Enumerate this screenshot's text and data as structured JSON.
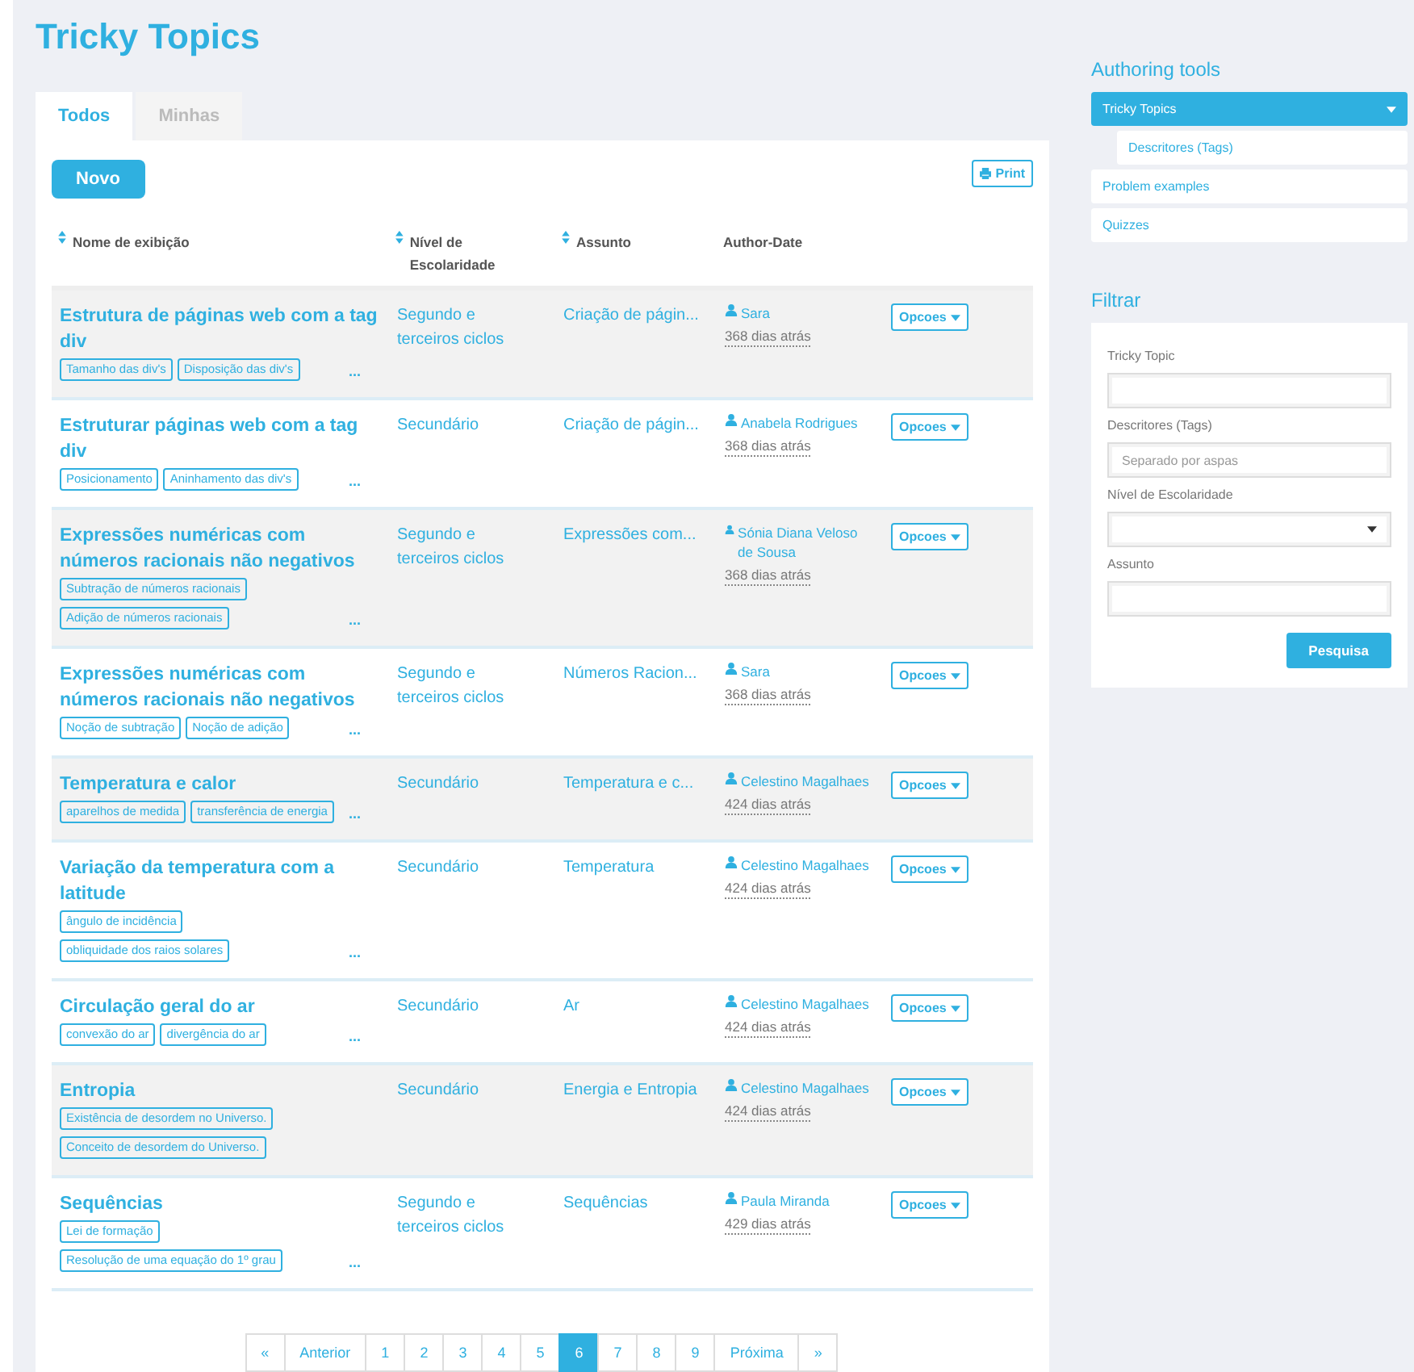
{
  "page_title": "Tricky Topics",
  "tabs": [
    {
      "label": "Todos",
      "selected": true
    },
    {
      "label": "Minhas",
      "selected": false
    }
  ],
  "new_button": "Novo",
  "print_button": "Print",
  "table": {
    "columns": [
      {
        "label": "Nome de exibição",
        "sortable": true
      },
      {
        "label": "Nível de Escolaridade",
        "sortable": true
      },
      {
        "label": "Assunto",
        "sortable": true
      },
      {
        "label": "Author-Date",
        "sortable": false
      }
    ],
    "rows": [
      {
        "shaded": true,
        "title": "Estrutura de páginas web com a tag div",
        "tags": [
          "Tamanho das div's",
          "Disposição das div's"
        ],
        "more": "...",
        "level": "Segundo e terceiros ciclos",
        "subject": "Criação de págin...",
        "author": "Sara",
        "date": "368 dias atrás",
        "options": "Opcoes"
      },
      {
        "shaded": false,
        "title": "Estruturar páginas web com a tag div",
        "tags": [
          "Posicionamento",
          "Aninhamento das div's"
        ],
        "more": "...",
        "level": "Secundário",
        "subject": "Criação de págin...",
        "author": "Anabela Rodrigues",
        "date": "368 dias atrás",
        "options": "Opcoes"
      },
      {
        "shaded": true,
        "title": "Expressões numéricas com números racionais não negativos",
        "tags": [
          "Subtração de números racionais",
          "Adição de números racionais"
        ],
        "more": "...",
        "level": "Segundo e terceiros ciclos",
        "subject": "Expressões com...",
        "author": "Sónia Diana Veloso de Sousa",
        "date": "368 dias atrás",
        "options": "Opcoes"
      },
      {
        "shaded": false,
        "title": "Expressões numéricas com números racionais não negativos",
        "tags": [
          "Noção de subtração",
          "Noção de adição"
        ],
        "more": "...",
        "level": "Segundo e terceiros ciclos",
        "subject": "Números Racion...",
        "author": "Sara",
        "date": "368 dias atrás",
        "options": "Opcoes"
      },
      {
        "shaded": true,
        "title": "Temperatura e calor",
        "tags": [
          "aparelhos de medida",
          "transferência de energia"
        ],
        "more": "...",
        "level": "Secundário",
        "subject": "Temperatura e c...",
        "author": "Celestino Magalhaes",
        "date": "424 dias atrás",
        "options": "Opcoes"
      },
      {
        "shaded": false,
        "title": "Variação da temperatura com a latitude",
        "tags": [
          "ângulo de incidência",
          "obliquidade dos raios solares"
        ],
        "more": "...",
        "level": "Secundário",
        "subject": "Temperatura",
        "author": "Celestino Magalhaes",
        "date": "424 dias atrás",
        "options": "Opcoes"
      },
      {
        "shaded": false,
        "title": "Circulação geral do ar",
        "tags": [
          "convexão do ar",
          "divergência do ar"
        ],
        "more": "...",
        "level": "Secundário",
        "subject": "Ar",
        "author": "Celestino Magalhaes",
        "date": "424 dias atrás",
        "options": "Opcoes"
      },
      {
        "shaded": true,
        "title": "Entropia",
        "tags": [
          "Existência de desordem no Universo.",
          "Conceito de desordem do Universo."
        ],
        "level": "Secundário",
        "subject": "Energia e Entropia",
        "author": "Celestino Magalhaes",
        "date": "424 dias atrás",
        "options": "Opcoes"
      },
      {
        "shaded": false,
        "title": "Sequências",
        "tags": [
          "Lei de formação",
          "Resolução de uma equação do 1º grau"
        ],
        "more": "...",
        "level": "Segundo e terceiros ciclos",
        "subject": "Sequências",
        "author": "Paula Miranda",
        "date": "429 dias atrás",
        "options": "Opcoes"
      }
    ]
  },
  "pagination": [
    {
      "label": "«",
      "selected": false
    },
    {
      "label": "Anterior",
      "selected": false
    },
    {
      "label": "1",
      "selected": false
    },
    {
      "label": "2",
      "selected": false
    },
    {
      "label": "3",
      "selected": false
    },
    {
      "label": "4",
      "selected": false
    },
    {
      "label": "5",
      "selected": false
    },
    {
      "label": "6",
      "selected": true
    },
    {
      "label": "7",
      "selected": false
    },
    {
      "label": "8",
      "selected": false
    },
    {
      "label": "9",
      "selected": false
    },
    {
      "label": "Próxima",
      "selected": false
    },
    {
      "label": "»",
      "selected": false
    }
  ],
  "sidebar": {
    "heading": "Authoring tools",
    "items": [
      {
        "label": "Tricky Topics",
        "selected": true,
        "children": [
          {
            "label": "Descritores (Tags)",
            "selected": false
          }
        ]
      },
      {
        "label": "Problem examples",
        "selected": false
      },
      {
        "label": "Quizzes",
        "selected": false
      }
    ]
  },
  "filter": {
    "heading": "Filtrar",
    "fields": [
      {
        "kind": "text",
        "label": "Tricky Topic"
      },
      {
        "kind": "text",
        "label": "Descritores (Tags)",
        "placeholder": "Separado por aspas"
      },
      {
        "kind": "select",
        "label": "Nível de Escolaridade"
      },
      {
        "kind": "text",
        "label": "Assunto"
      }
    ],
    "button": "Pesquisa"
  }
}
